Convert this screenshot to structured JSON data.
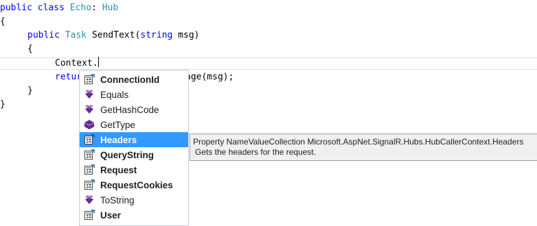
{
  "code": {
    "line1": {
      "kw": "public",
      "kw2": "class",
      "name": "Echo",
      "sep": ": ",
      "base": "Hub"
    },
    "line2": "{",
    "line3": {
      "kw": "public",
      "type": "Task",
      "method": "SendText(",
      "ptype": "string",
      "param": " msg)"
    },
    "line4": "{",
    "line5": "Context.",
    "line6_left": "retur",
    "line6_right": "age(msg);",
    "line7": "}",
    "line8": "}"
  },
  "completion": {
    "items": [
      {
        "label": "ConnectionId",
        "icon": "property-icon",
        "bold": true
      },
      {
        "label": "Equals",
        "icon": "method-icon",
        "bold": false
      },
      {
        "label": "GetHashCode",
        "icon": "method-icon",
        "bold": false
      },
      {
        "label": "GetType",
        "icon": "method-purple-icon",
        "bold": false
      },
      {
        "label": "Headers",
        "icon": "property-icon",
        "bold": true,
        "selected": true
      },
      {
        "label": "QueryString",
        "icon": "property-icon",
        "bold": true
      },
      {
        "label": "Request",
        "icon": "property-icon",
        "bold": true
      },
      {
        "label": "RequestCookies",
        "icon": "property-icon",
        "bold": true
      },
      {
        "label": "ToString",
        "icon": "method-icon",
        "bold": false
      },
      {
        "label": "User",
        "icon": "property-icon",
        "bold": true
      }
    ]
  },
  "tooltip": {
    "signature": "Property NameValueCollection Microsoft.AspNet.SignalR.Hubs.HubCallerContext.Headers",
    "description": "Gets the headers for the request."
  },
  "colors": {
    "keyword": "#0000ff",
    "type": "#2b91af",
    "selection": "#3399ff"
  }
}
